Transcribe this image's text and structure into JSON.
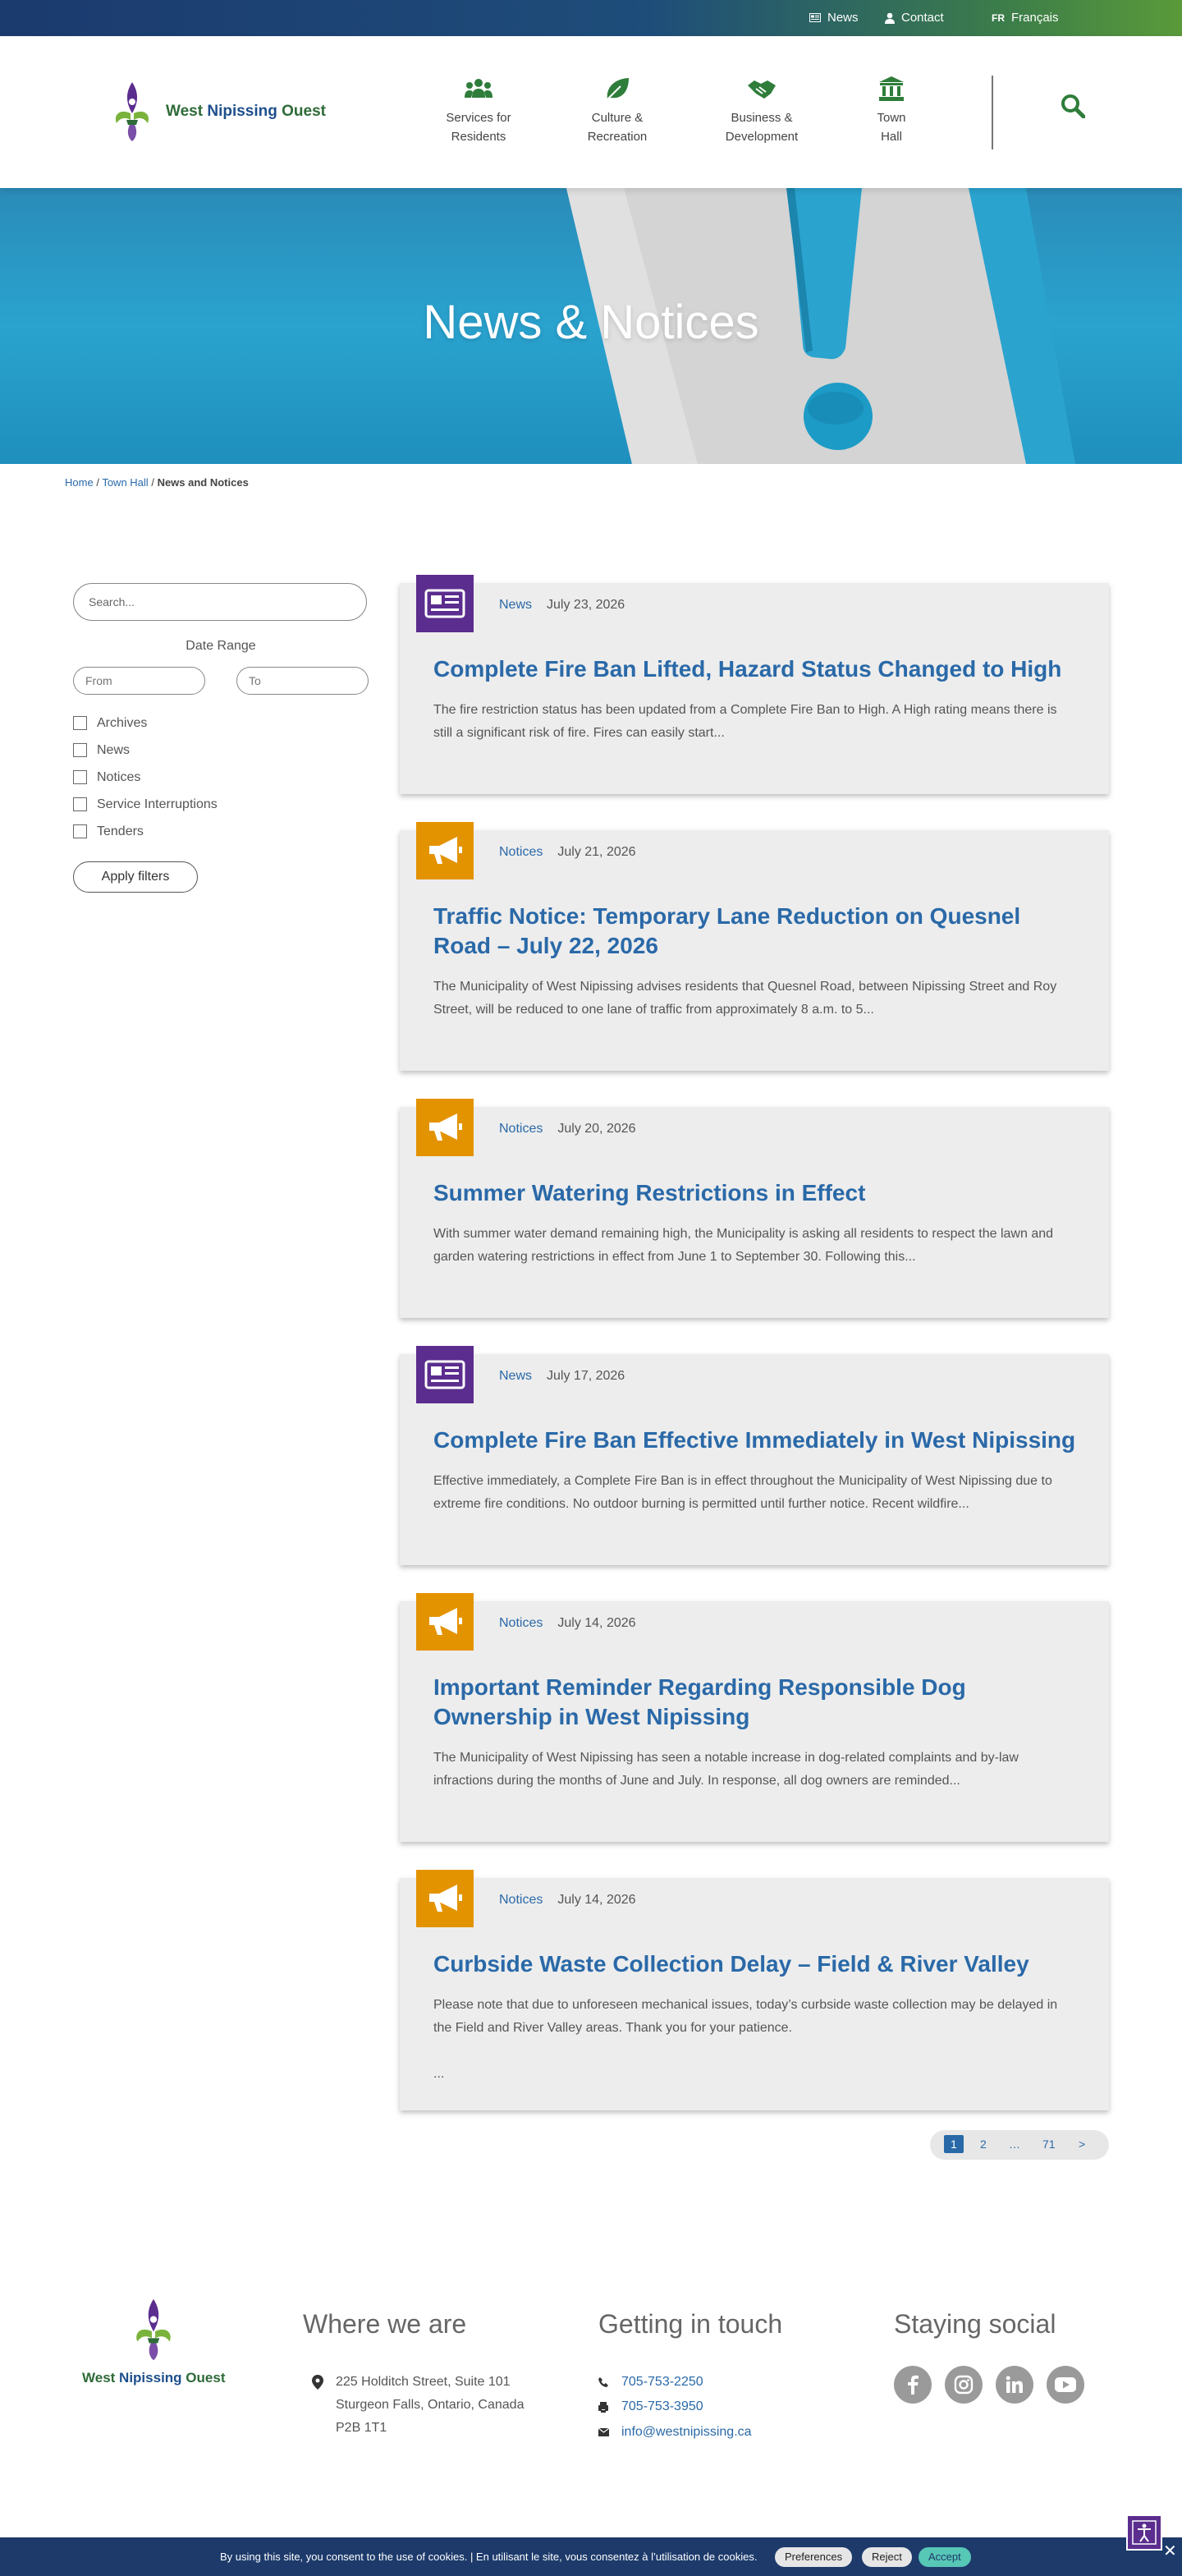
{
  "topbar": {
    "news_label": "News",
    "contact_label": "Contact",
    "lang_code": "FR",
    "lang_label": "Français"
  },
  "header": {
    "logo_word1": "West",
    "logo_word2": "Nipissing",
    "logo_word3": "Ouest",
    "nav": [
      {
        "line1": "Services for",
        "line2": "Residents",
        "icon": "people-icon"
      },
      {
        "line1": "Culture &",
        "line2": "Recreation",
        "icon": "leaf-icon"
      },
      {
        "line1": "Business &",
        "line2": "Development",
        "icon": "handshake-icon"
      },
      {
        "line1": "Town",
        "line2": "Hall",
        "icon": "town-hall-icon"
      }
    ]
  },
  "hero": {
    "title": "News & Notices"
  },
  "breadcrumb": {
    "home": "Home",
    "sep": "/",
    "town_hall": "Town Hall",
    "current": "News and Notices"
  },
  "filters": {
    "search_placeholder": "Search...",
    "date_range_label": "Date Range",
    "from_placeholder": "From",
    "to_placeholder": "To",
    "categories": [
      "Archives",
      "News",
      "Notices",
      "Service Interruptions",
      "Tenders"
    ],
    "apply_label": "Apply filters"
  },
  "posts": [
    {
      "category": "News",
      "date": "July 23, 2026",
      "title": "Complete Fire Ban Lifted, Hazard Status Changed to High",
      "excerpt": "The fire restriction status has been updated from a Complete Fire Ban to High. A High rating means there is still a significant risk of fire. Fires can easily start...",
      "extra": ""
    },
    {
      "category": "Notices",
      "date": "July 21, 2026",
      "title": "Traffic Notice: Temporary Lane Reduction on Quesnel Road – July 22, 2026",
      "excerpt": "The Municipality of West Nipissing advises residents that Quesnel Road, between Nipissing Street and Roy Street, will be reduced to one lane of traffic from approximately 8 a.m. to 5...",
      "extra": ""
    },
    {
      "category": "Notices",
      "date": "July 20, 2026",
      "title": "Summer Watering Restrictions in Effect",
      "excerpt": "With summer water demand remaining high, the Municipality is asking all residents to respect the lawn and garden watering restrictions in effect from June 1 to September 30. Following this...",
      "extra": ""
    },
    {
      "category": "News",
      "date": "July 17, 2026",
      "title": "Complete Fire Ban Effective Immediately in West Nipissing",
      "excerpt": "Effective immediately, a Complete Fire Ban is in effect throughout the Municipality of West Nipissing due to extreme fire conditions. No outdoor burning is permitted until further notice. Recent wildfire...",
      "extra": ""
    },
    {
      "category": "Notices",
      "date": "July 14, 2026",
      "title": "Important Reminder Regarding Responsible Dog Ownership in West Nipissing",
      "excerpt": "The Municipality of West Nipissing has seen a notable increase in dog-related complaints and by-law infractions during the months of June and July. In response, all dog owners are reminded...",
      "extra": ""
    },
    {
      "category": "Notices",
      "date": "July 14, 2026",
      "title": "Curbside Waste Collection Delay – Field & River Valley",
      "excerpt": "Please note that due to unforeseen mechanical issues, today’s curbside waste collection may be delayed in the Field and River Valley areas. Thank you for your patience.",
      "extra": "..."
    }
  ],
  "pagination": {
    "current": "1",
    "next_page": "2",
    "ellipsis": "…",
    "last": "71",
    "next_arrow": ">"
  },
  "footer": {
    "logo_word1": "West",
    "logo_word2": "Nipissing",
    "logo_word3": "Ouest",
    "where_title": "Where we are",
    "address_line1": "225 Holditch Street, Suite 101",
    "address_line2": "Sturgeon Falls, Ontario, Canada",
    "address_line3": "P2B 1T1",
    "contact_title": "Getting in touch",
    "phone": "705-753-2250",
    "fax": "705-753-3950",
    "email": "info@westnipissing.ca",
    "social_title": "Staying social"
  },
  "cookie": {
    "message": "By using this site, you consent to the use of cookies. | En utilisant le site, vous consentez à l’utilisation de cookies.",
    "preferences": "Preferences",
    "reject": "Reject",
    "accept": "Accept"
  },
  "colors": {
    "link_blue": "#2a69a8",
    "news_purple": "#5b2d8e",
    "notice_orange": "#e39300",
    "accept_teal": "#57c7b6"
  }
}
